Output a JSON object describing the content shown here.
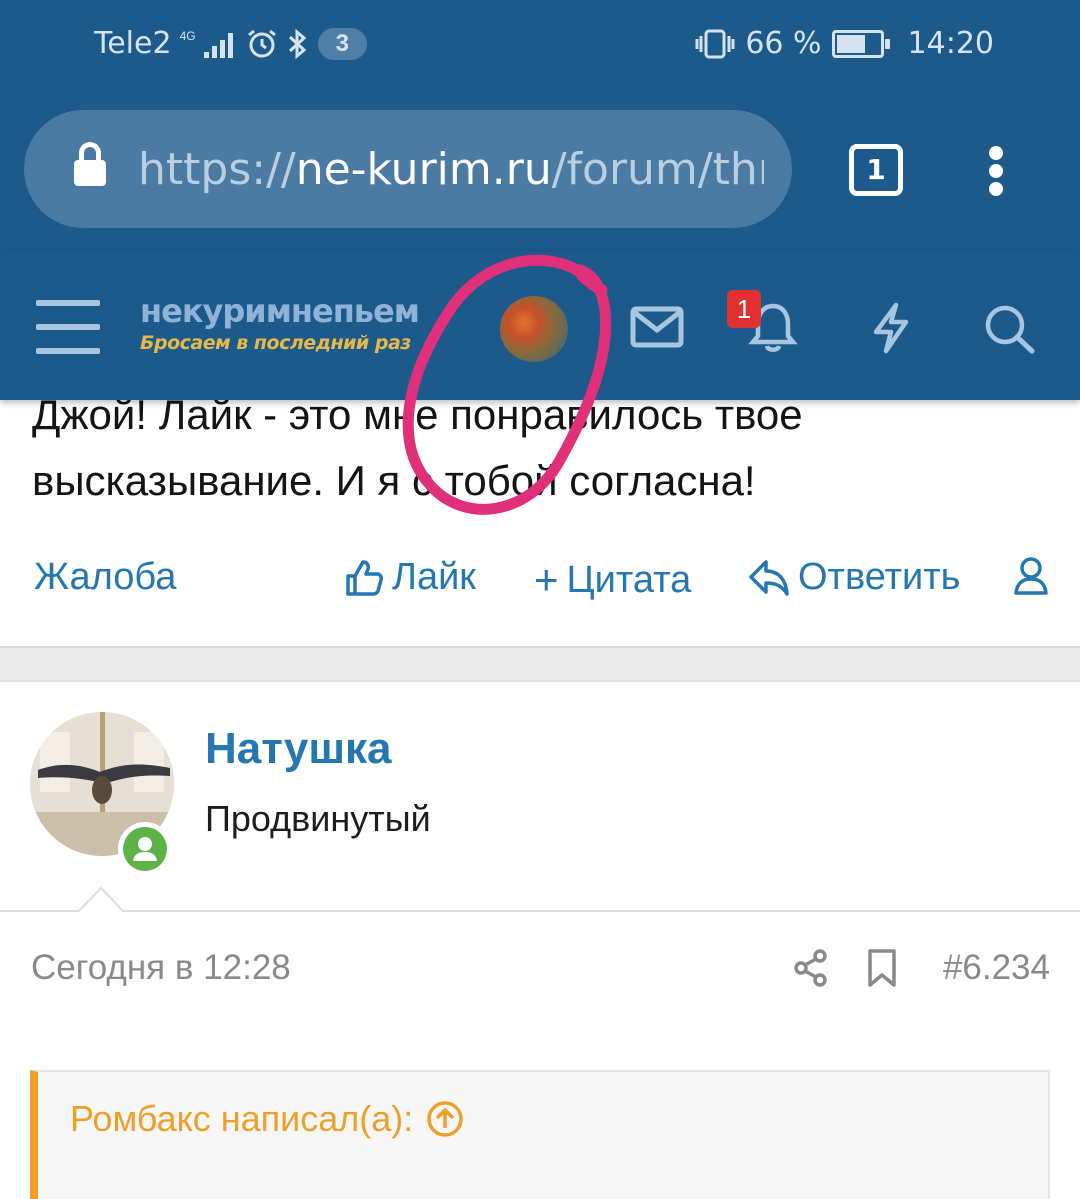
{
  "status_bar": {
    "carrier": "Tele2",
    "network": "4G",
    "notification_count": "3",
    "battery": "66 %",
    "battery_level": 0.66,
    "time": "14:20"
  },
  "browser": {
    "url_scheme": "https://",
    "url_host": "ne-kurim.ru",
    "url_path": "/forum/thr",
    "tab_count": "1"
  },
  "site_header": {
    "logo_top": "некуримнепьем",
    "logo_bottom": "Бросаем в последний раз",
    "alerts_badge": "1"
  },
  "post": {
    "text": "Джой! Лайк - это мне понравилось твое высказывание. И я с тобой согласна!",
    "actions": {
      "report": "Жалоба",
      "like": "Лайк",
      "quote": "Цитата",
      "reply": "Ответить"
    }
  },
  "next_post": {
    "username": "Натушка",
    "user_title": "Продвинутый",
    "date": "Сегодня в 12:28",
    "post_number": "#6.234",
    "quote_header": "Ромбакс написал(а):"
  },
  "colors": {
    "chrome_blue": "#1c5a8c",
    "link_blue": "#2577b1",
    "quote_orange": "#f0a02a",
    "online_green": "#5eb347",
    "annotation_pink": "#e0307a",
    "badge_red": "#e03030"
  }
}
